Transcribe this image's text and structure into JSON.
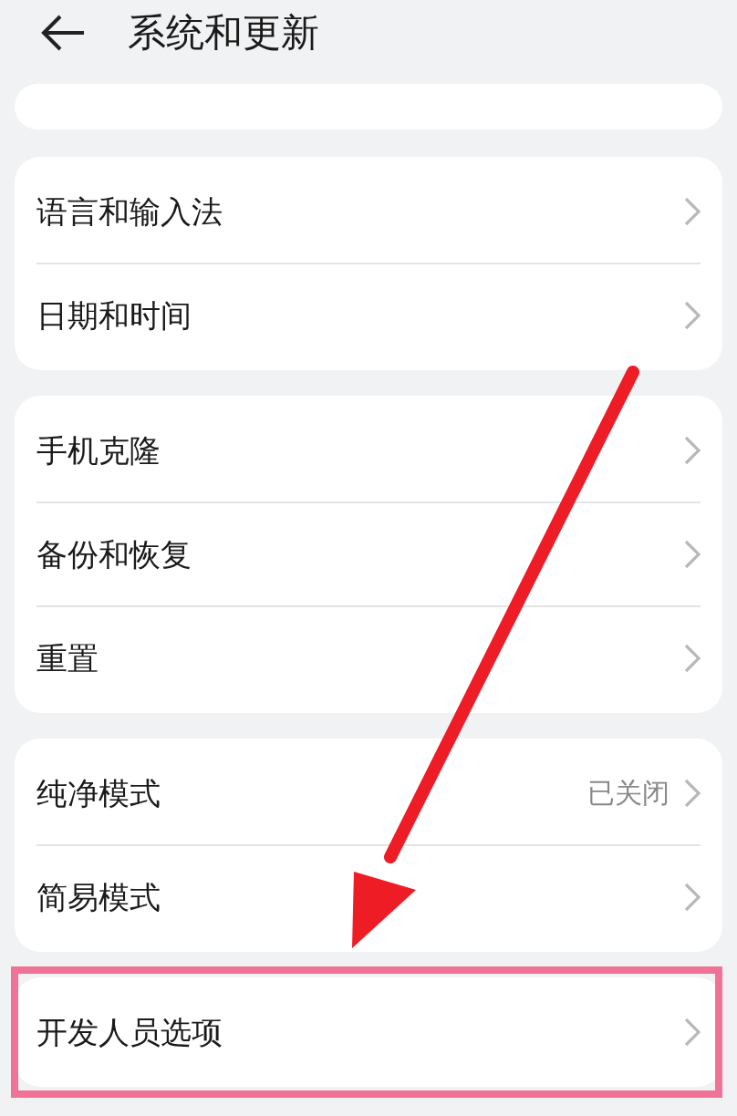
{
  "header": {
    "title": "系统和更新"
  },
  "groups": [
    {
      "rows": [
        {
          "label": "语言和输入法",
          "highlighted": false
        },
        {
          "label": "日期和时间",
          "highlighted": false
        }
      ]
    },
    {
      "rows": [
        {
          "label": "手机克隆",
          "highlighted": false
        },
        {
          "label": "备份和恢复",
          "highlighted": false
        },
        {
          "label": "重置",
          "highlighted": false
        }
      ]
    },
    {
      "rows": [
        {
          "label": "纯净模式",
          "value": "已关闭",
          "highlighted": false
        },
        {
          "label": "简易模式",
          "highlighted": false
        }
      ]
    },
    {
      "rows": [
        {
          "label": "开发人员选项",
          "highlighted": true
        }
      ]
    }
  ],
  "arrow_annotation": true
}
